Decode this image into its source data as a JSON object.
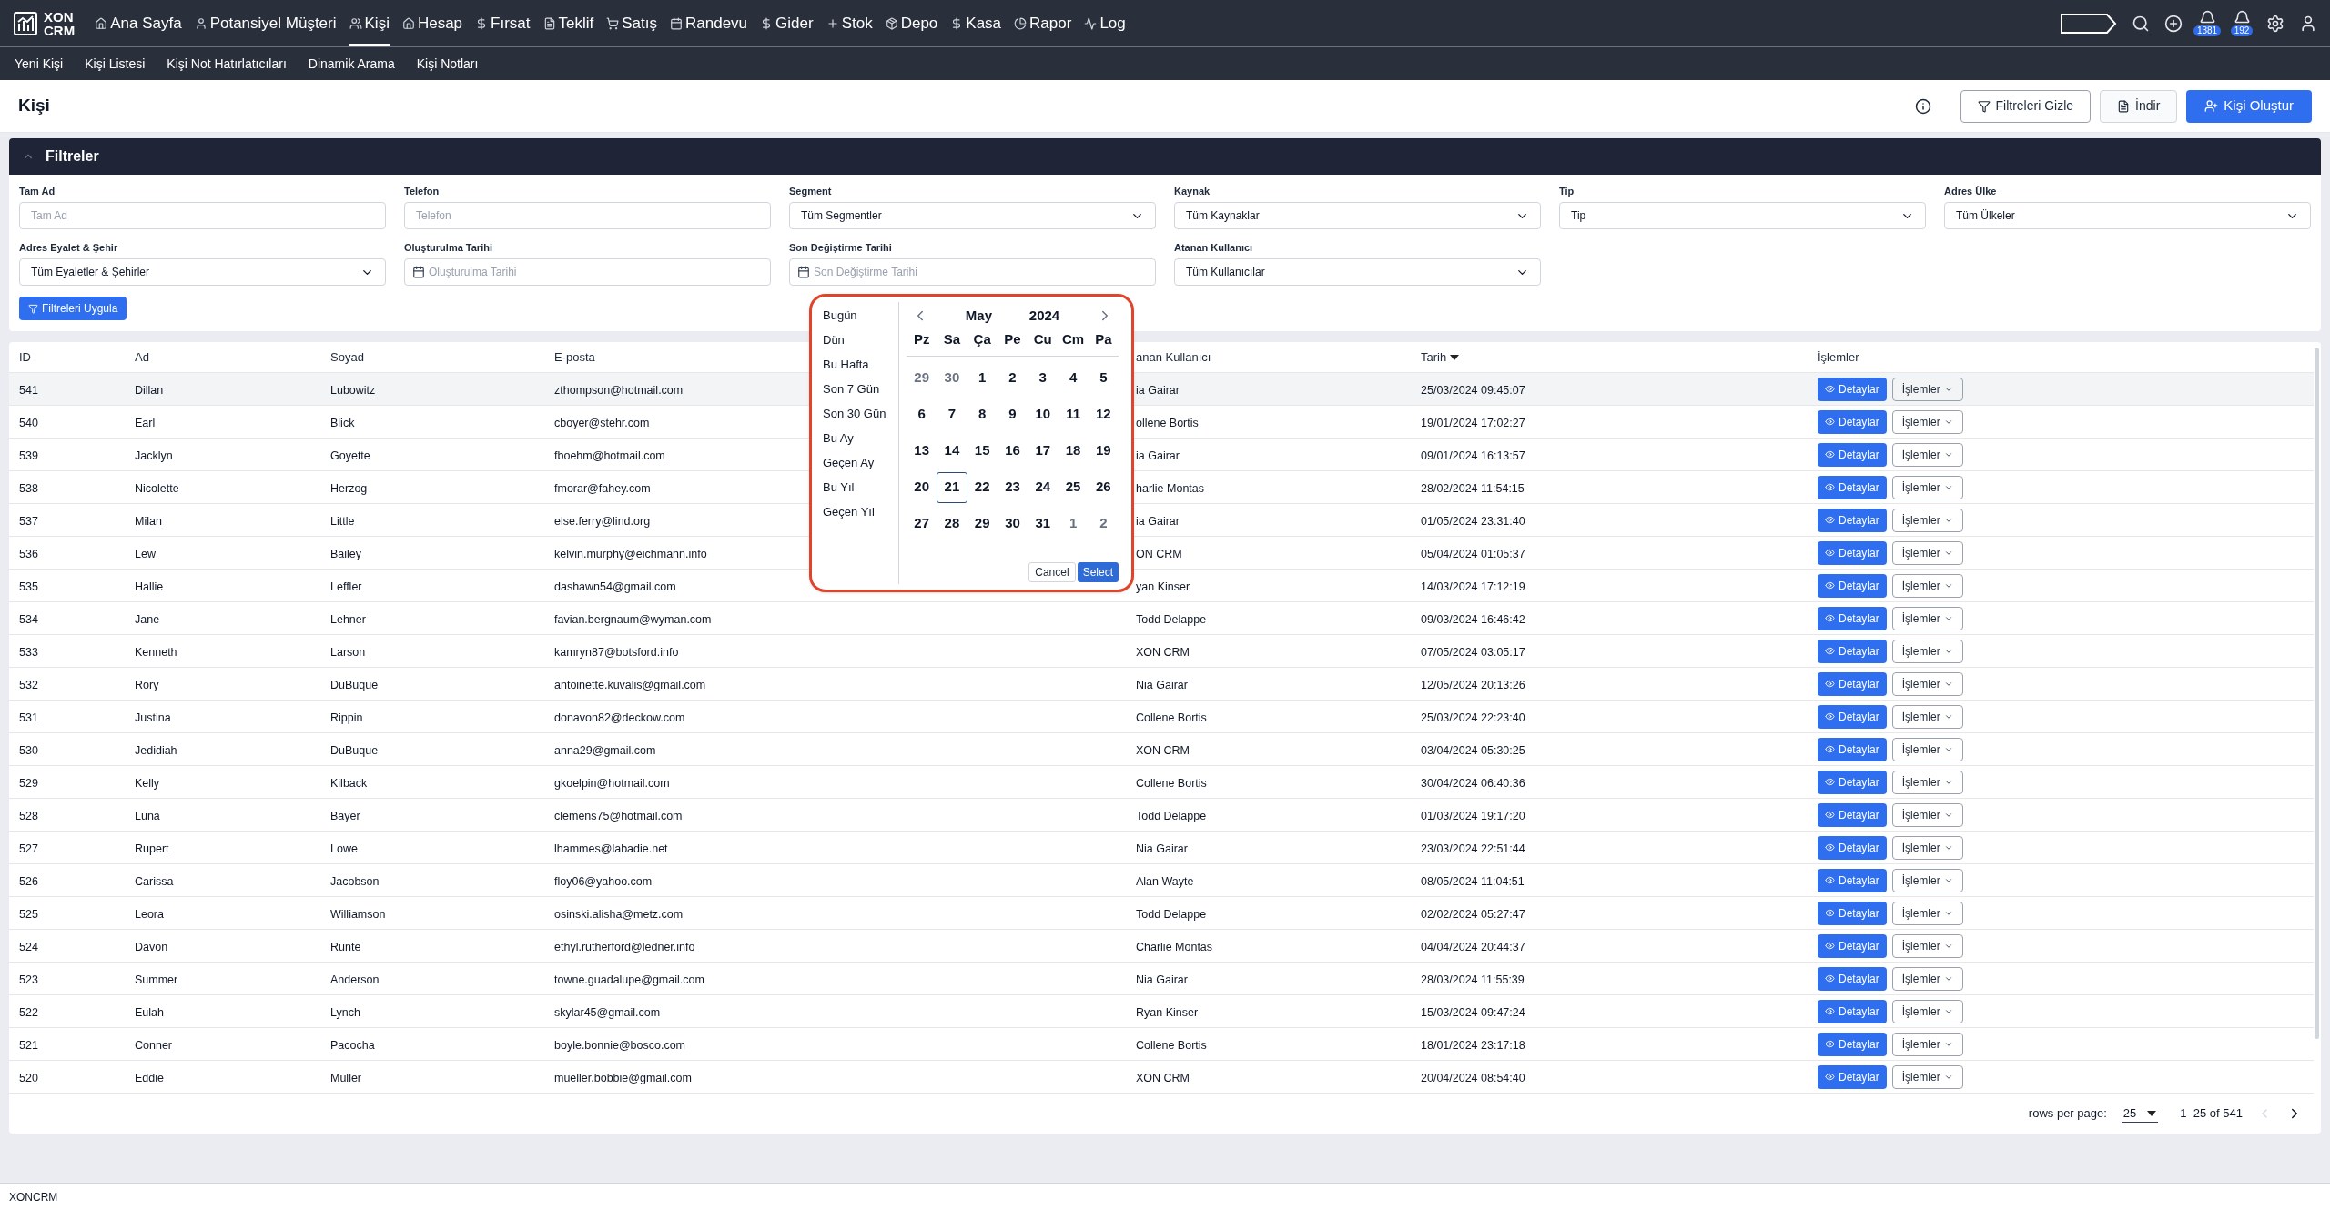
{
  "brand": {
    "line1": "XON",
    "line2": "CRM"
  },
  "nav": [
    {
      "label": "Ana Sayfa",
      "selected": false
    },
    {
      "label": "Potansiyel Müşteri",
      "selected": false
    },
    {
      "label": "Kişi",
      "selected": true
    },
    {
      "label": "Hesap",
      "selected": false
    },
    {
      "label": "Fırsat",
      "selected": false
    },
    {
      "label": "Teklif",
      "selected": false
    },
    {
      "label": "Satış",
      "selected": false
    },
    {
      "label": "Randevu",
      "selected": false
    },
    {
      "label": "Gider",
      "selected": false
    },
    {
      "label": "Stok",
      "selected": false
    },
    {
      "label": "Depo",
      "selected": false
    },
    {
      "label": "Kasa",
      "selected": false
    },
    {
      "label": "Rapor",
      "selected": false
    },
    {
      "label": "Log",
      "selected": false
    }
  ],
  "badges": [
    "1381",
    "192"
  ],
  "subnav": [
    "Yeni Kişi",
    "Kişi Listesi",
    "Kişi Not Hatırlatıcıları",
    "Dinamik Arama",
    "Kişi Notları"
  ],
  "page_title": "Kişi",
  "actions": [
    "Filtreleri Gizle",
    "İndir",
    "Kişi Oluştur"
  ],
  "filters": {
    "title": "Filtreler",
    "fields": [
      {
        "label": "Tam Ad",
        "kind": "text",
        "placeholder": "Tam Ad"
      },
      {
        "label": "Telefon",
        "kind": "text",
        "placeholder": "Telefon"
      },
      {
        "label": "Segment",
        "kind": "select",
        "value": "Tüm Segmentler"
      },
      {
        "label": "Kaynak",
        "kind": "select",
        "value": "Tüm Kaynaklar"
      },
      {
        "label": "Tip",
        "kind": "select",
        "value": "Tip"
      },
      {
        "label": "Adres Ülke",
        "kind": "select",
        "value": "Tüm Ülkeler"
      },
      {
        "label": "Adres Eyalet & Şehir",
        "kind": "select",
        "value": "Tüm Eyaletler & Şehirler"
      },
      {
        "label": "Oluşturulma Tarihi",
        "kind": "date",
        "placeholder": "Oluşturulma Tarihi"
      },
      {
        "label": "Son Değiştirme Tarihi",
        "kind": "date",
        "placeholder": "Son Değiştirme Tarihi"
      },
      {
        "label": "Atanan Kullanıcı",
        "kind": "select",
        "value": "Tüm Kullanıcılar"
      }
    ],
    "apply": "Filtreleri Uygula"
  },
  "datepicker": {
    "presets": [
      "Bugün",
      "Dün",
      "Bu Hafta",
      "Son 7 Gün",
      "Son 30 Gün",
      "Bu Ay",
      "Geçen Ay",
      "Bu Yıl",
      "Geçen Yıl"
    ],
    "month": "May",
    "year": "2024",
    "weekdays": [
      "Pz",
      "Sa",
      "Ça",
      "Pe",
      "Cu",
      "Cm",
      "Pa"
    ],
    "weeks": [
      [
        {
          "label": "29",
          "outside": true,
          "selected": false
        },
        {
          "label": "30",
          "outside": true,
          "selected": false
        },
        {
          "label": "1",
          "outside": false,
          "selected": false
        },
        {
          "label": "2",
          "outside": false,
          "selected": false
        },
        {
          "label": "3",
          "outside": false,
          "selected": false
        },
        {
          "label": "4",
          "outside": false,
          "selected": false
        },
        {
          "label": "5",
          "outside": false,
          "selected": false
        }
      ],
      [
        {
          "label": "6",
          "outside": false,
          "selected": false
        },
        {
          "label": "7",
          "outside": false,
          "selected": false
        },
        {
          "label": "8",
          "outside": false,
          "selected": false
        },
        {
          "label": "9",
          "outside": false,
          "selected": false
        },
        {
          "label": "10",
          "outside": false,
          "selected": false
        },
        {
          "label": "11",
          "outside": false,
          "selected": false
        },
        {
          "label": "12",
          "outside": false,
          "selected": false
        }
      ],
      [
        {
          "label": "13",
          "outside": false,
          "selected": false
        },
        {
          "label": "14",
          "outside": false,
          "selected": false
        },
        {
          "label": "15",
          "outside": false,
          "selected": false
        },
        {
          "label": "16",
          "outside": false,
          "selected": false
        },
        {
          "label": "17",
          "outside": false,
          "selected": false
        },
        {
          "label": "18",
          "outside": false,
          "selected": false
        },
        {
          "label": "19",
          "outside": false,
          "selected": false
        }
      ],
      [
        {
          "label": "20",
          "outside": false,
          "selected": false
        },
        {
          "label": "21",
          "outside": false,
          "selected": true
        },
        {
          "label": "22",
          "outside": false,
          "selected": false
        },
        {
          "label": "23",
          "outside": false,
          "selected": false
        },
        {
          "label": "24",
          "outside": false,
          "selected": false
        },
        {
          "label": "25",
          "outside": false,
          "selected": false
        },
        {
          "label": "26",
          "outside": false,
          "selected": false
        }
      ],
      [
        {
          "label": "27",
          "outside": false,
          "selected": false
        },
        {
          "label": "28",
          "outside": false,
          "selected": false
        },
        {
          "label": "29",
          "outside": false,
          "selected": false
        },
        {
          "label": "30",
          "outside": false,
          "selected": false
        },
        {
          "label": "31",
          "outside": false,
          "selected": false
        },
        {
          "label": "1",
          "outside": true,
          "selected": false
        },
        {
          "label": "2",
          "outside": true,
          "selected": false
        }
      ]
    ],
    "cancel": "Cancel",
    "select": "Select"
  },
  "table": {
    "columns": [
      "ID",
      "Ad",
      "Soyad",
      "E-posta",
      "anan Kullanıcı",
      "Tarih",
      "İşlemler"
    ],
    "rows": [
      {
        "cells": [
          "541",
          "Dillan",
          "Lubowitz",
          "zthompson@hotmail.com",
          "ia Gairar",
          "25/03/2024 09:45:07"
        ],
        "detail_label": "Detaylar",
        "menu_label": "İşlemler",
        "highlighted": true
      },
      {
        "cells": [
          "540",
          "Earl",
          "Blick",
          "cboyer@stehr.com",
          "ollene Bortis",
          "19/01/2024 17:02:27"
        ],
        "detail_label": "Detaylar",
        "menu_label": "İşlemler",
        "highlighted": false
      },
      {
        "cells": [
          "539",
          "Jacklyn",
          "Goyette",
          "fboehm@hotmail.com",
          "ia Gairar",
          "09/01/2024 16:13:57"
        ],
        "detail_label": "Detaylar",
        "menu_label": "İşlemler",
        "highlighted": false
      },
      {
        "cells": [
          "538",
          "Nicolette",
          "Herzog",
          "fmorar@fahey.com",
          "harlie Montas",
          "28/02/2024 11:54:15"
        ],
        "detail_label": "Detaylar",
        "menu_label": "İşlemler",
        "highlighted": false
      },
      {
        "cells": [
          "537",
          "Milan",
          "Little",
          "else.ferry@lind.org",
          "ia Gairar",
          "01/05/2024 23:31:40"
        ],
        "detail_label": "Detaylar",
        "menu_label": "İşlemler",
        "highlighted": false
      },
      {
        "cells": [
          "536",
          "Lew",
          "Bailey",
          "kelvin.murphy@eichmann.info",
          "ON CRM",
          "05/04/2024 01:05:37"
        ],
        "detail_label": "Detaylar",
        "menu_label": "İşlemler",
        "highlighted": false
      },
      {
        "cells": [
          "535",
          "Hallie",
          "Leffler",
          "dashawn54@gmail.com",
          "yan Kinser",
          "14/03/2024 17:12:19"
        ],
        "detail_label": "Detaylar",
        "menu_label": "İşlemler",
        "highlighted": false
      },
      {
        "cells": [
          "534",
          "Jane",
          "Lehner",
          "favian.bergnaum@wyman.com",
          "Todd Delappe",
          "09/03/2024 16:46:42"
        ],
        "detail_label": "Detaylar",
        "menu_label": "İşlemler",
        "highlighted": false
      },
      {
        "cells": [
          "533",
          "Kenneth",
          "Larson",
          "kamryn87@botsford.info",
          "XON CRM",
          "07/05/2024 03:05:17"
        ],
        "detail_label": "Detaylar",
        "menu_label": "İşlemler",
        "highlighted": false
      },
      {
        "cells": [
          "532",
          "Rory",
          "DuBuque",
          "antoinette.kuvalis@gmail.com",
          "Nia Gairar",
          "12/05/2024 20:13:26"
        ],
        "detail_label": "Detaylar",
        "menu_label": "İşlemler",
        "highlighted": false
      },
      {
        "cells": [
          "531",
          "Justina",
          "Rippin",
          "donavon82@deckow.com",
          "Collene Bortis",
          "25/03/2024 22:23:40"
        ],
        "detail_label": "Detaylar",
        "menu_label": "İşlemler",
        "highlighted": false
      },
      {
        "cells": [
          "530",
          "Jedidiah",
          "DuBuque",
          "anna29@gmail.com",
          "XON CRM",
          "03/04/2024 05:30:25"
        ],
        "detail_label": "Detaylar",
        "menu_label": "İşlemler",
        "highlighted": false
      },
      {
        "cells": [
          "529",
          "Kelly",
          "Kilback",
          "gkoelpin@hotmail.com",
          "Collene Bortis",
          "30/04/2024 06:40:36"
        ],
        "detail_label": "Detaylar",
        "menu_label": "İşlemler",
        "highlighted": false
      },
      {
        "cells": [
          "528",
          "Luna",
          "Bayer",
          "clemens75@hotmail.com",
          "Todd Delappe",
          "01/03/2024 19:17:20"
        ],
        "detail_label": "Detaylar",
        "menu_label": "İşlemler",
        "highlighted": false
      },
      {
        "cells": [
          "527",
          "Rupert",
          "Lowe",
          "lhammes@labadie.net",
          "Nia Gairar",
          "23/03/2024 22:51:44"
        ],
        "detail_label": "Detaylar",
        "menu_label": "İşlemler",
        "highlighted": false
      },
      {
        "cells": [
          "526",
          "Carissa",
          "Jacobson",
          "floy06@yahoo.com",
          "Alan Wayte",
          "08/05/2024 11:04:51"
        ],
        "detail_label": "Detaylar",
        "menu_label": "İşlemler",
        "highlighted": false
      },
      {
        "cells": [
          "525",
          "Leora",
          "Williamson",
          "osinski.alisha@metz.com",
          "Todd Delappe",
          "02/02/2024 05:27:47"
        ],
        "detail_label": "Detaylar",
        "menu_label": "İşlemler",
        "highlighted": false
      },
      {
        "cells": [
          "524",
          "Davon",
          "Runte",
          "ethyl.rutherford@ledner.info",
          "Charlie Montas",
          "04/04/2024 20:44:37"
        ],
        "detail_label": "Detaylar",
        "menu_label": "İşlemler",
        "highlighted": false
      },
      {
        "cells": [
          "523",
          "Summer",
          "Anderson",
          "towne.guadalupe@gmail.com",
          "Nia Gairar",
          "28/03/2024 11:55:39"
        ],
        "detail_label": "Detaylar",
        "menu_label": "İşlemler",
        "highlighted": false
      },
      {
        "cells": [
          "522",
          "Eulah",
          "Lynch",
          "skylar45@gmail.com",
          "Ryan Kinser",
          "15/03/2024 09:47:24"
        ],
        "detail_label": "Detaylar",
        "menu_label": "İşlemler",
        "highlighted": false
      },
      {
        "cells": [
          "521",
          "Conner",
          "Pacocha",
          "boyle.bonnie@bosco.com",
          "Collene Bortis",
          "18/01/2024 23:17:18"
        ],
        "detail_label": "Detaylar",
        "menu_label": "İşlemler",
        "highlighted": false
      },
      {
        "cells": [
          "520",
          "Eddie",
          "Muller",
          "mueller.bobbie@gmail.com",
          "XON CRM",
          "20/04/2024 08:54:40"
        ],
        "detail_label": "Detaylar",
        "menu_label": "İşlemler",
        "highlighted": false
      }
    ]
  },
  "pagination": {
    "label": "rows per page:",
    "per_page": "25",
    "range": "1–25 of 541"
  },
  "footer": "XONCRM"
}
